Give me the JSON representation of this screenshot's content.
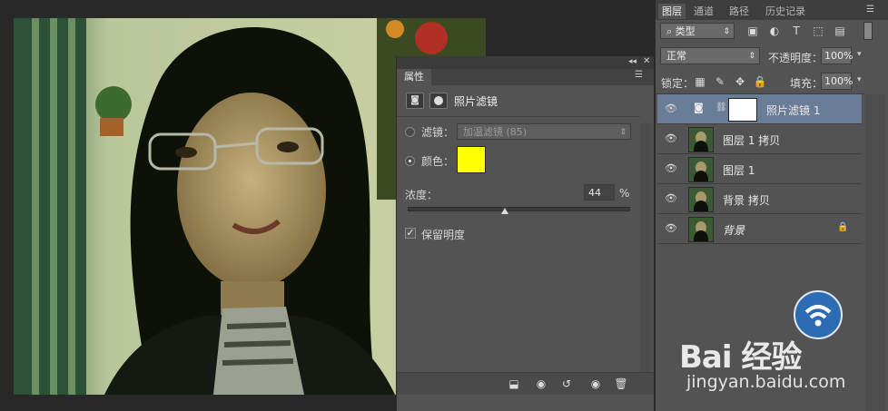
{
  "properties_panel": {
    "tab_title": "属性",
    "adjustment_name": "照片滤镜",
    "filter_label": "滤镜：",
    "filter_value": "加温滤镜 (85)",
    "color_label": "颜色：",
    "color_swatch": "#ffff00",
    "density_label": "浓度：",
    "density_value": "44",
    "density_unit": "%",
    "density_level": 0.44,
    "preserve_luminosity_label": "保留明度",
    "preserve_luminosity_checked": true
  },
  "layers_panel": {
    "tabs": [
      "图层",
      "通道",
      "路径",
      "历史记录"
    ],
    "kind_filter": "类型",
    "blend_mode": "正常",
    "opacity_label": "不透明度：",
    "opacity_value": "100%",
    "lock_label": "锁定：",
    "fill_label": "填充：",
    "fill_value": "100%",
    "layers": [
      {
        "name": "照片滤镜 1",
        "selected": true,
        "type": "adjustment"
      },
      {
        "name": "图层 1 拷贝",
        "selected": false,
        "type": "pixel"
      },
      {
        "name": "图层 1",
        "selected": false,
        "type": "pixel"
      },
      {
        "name": "背景 拷贝",
        "selected": false,
        "type": "pixel"
      },
      {
        "name": "背景",
        "selected": false,
        "type": "background",
        "locked": true
      }
    ]
  },
  "watermark": {
    "brand": "Bai 经验",
    "url": "jingyan.baidu.com"
  },
  "colors": {
    "panel_bg": "#535353",
    "selected_layer": "#6a7d96",
    "app_bg": "#282828"
  }
}
